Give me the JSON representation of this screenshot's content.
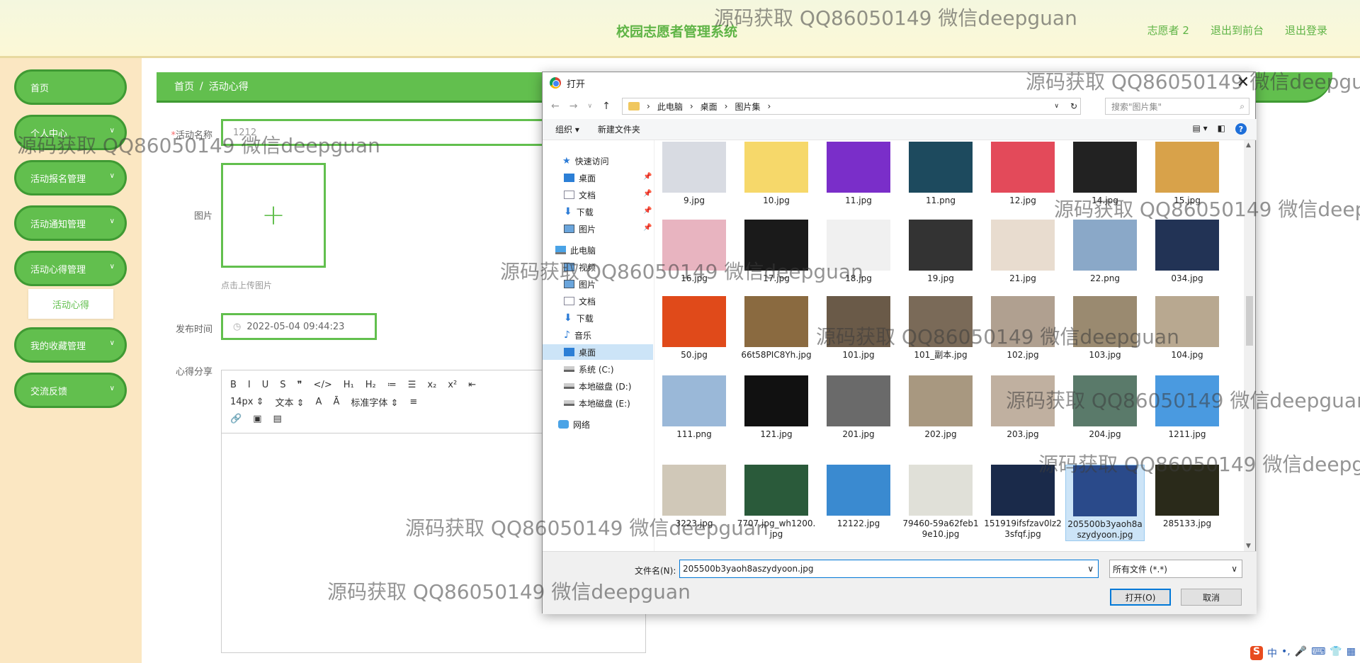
{
  "header": {
    "title": "校园志愿者管理系统",
    "links": [
      "志愿者 2",
      "退出到前台",
      "退出登录"
    ]
  },
  "sidebar": {
    "items": [
      {
        "label": "首页",
        "chevron": false
      },
      {
        "label": "个人中心",
        "chevron": true
      },
      {
        "label": "活动报名管理",
        "chevron": true
      },
      {
        "label": "活动通知管理",
        "chevron": true
      },
      {
        "label": "活动心得管理",
        "chevron": true
      },
      {
        "label": "我的收藏管理",
        "chevron": true
      },
      {
        "label": "交流反馈",
        "chevron": true
      }
    ],
    "sub_item": "活动心得"
  },
  "breadcrumb": {
    "home": "首页",
    "sep": "/",
    "current": "活动心得"
  },
  "form": {
    "name_label": "活动名称",
    "name_value": "1212",
    "image_label": "图片",
    "upload_plus": "+",
    "upload_tip": "点击上传图片",
    "time_label": "发布时间",
    "time_value": "2022-05-04 09:44:23",
    "share_label": "心得分享"
  },
  "editor": {
    "row1": [
      "B",
      "I",
      "U",
      "S",
      "❞",
      "</>",
      "H₁",
      "H₂",
      "≔",
      "☰",
      "x₂",
      "x²",
      "⇤"
    ],
    "row2": [
      "14px ⇕",
      "文本 ⇕",
      "A",
      "Ā",
      "标准字体 ⇕",
      "≡"
    ],
    "row3": [
      "🔗",
      "▣",
      "▤"
    ]
  },
  "dialog": {
    "title": "打开",
    "close": "✕",
    "path": [
      "此电脑",
      "桌面",
      "图片集"
    ],
    "search_placeholder": "搜索\"图片集\"",
    "organize": "组织 ▾",
    "new_folder": "新建文件夹",
    "help": "?",
    "tree": [
      {
        "label": "快速访问",
        "icon": "star",
        "pinned": false
      },
      {
        "label": "桌面",
        "icon": "desk",
        "pinned": true
      },
      {
        "label": "文档",
        "icon": "doc",
        "pinned": true
      },
      {
        "label": "下载",
        "icon": "dl",
        "pinned": true
      },
      {
        "label": "图片",
        "icon": "pic",
        "pinned": true
      },
      {
        "label": "此电脑",
        "icon": "pc",
        "pinned": false
      },
      {
        "label": "视频",
        "icon": "pic",
        "pinned": false
      },
      {
        "label": "图片",
        "icon": "pic",
        "pinned": false
      },
      {
        "label": "文档",
        "icon": "doc",
        "pinned": false
      },
      {
        "label": "下载",
        "icon": "dl",
        "pinned": false
      },
      {
        "label": "音乐",
        "icon": "music",
        "pinned": false
      },
      {
        "label": "桌面",
        "icon": "desk",
        "pinned": false,
        "selected": true
      },
      {
        "label": "系统 (C:)",
        "icon": "drive",
        "pinned": false
      },
      {
        "label": "本地磁盘 (D:)",
        "icon": "drive",
        "pinned": false
      },
      {
        "label": "本地磁盘 (E:)",
        "icon": "drive",
        "pinned": false
      },
      {
        "label": "网络",
        "icon": "net",
        "pinned": false
      }
    ],
    "files": [
      [
        "9.jpg",
        "#d8dbe2"
      ],
      [
        "10.jpg",
        "#f6d86a"
      ],
      [
        "11.jpg",
        "#7a2ec9"
      ],
      [
        "11.png",
        "#1d4a5e"
      ],
      [
        "12.jpg",
        "#e34a5a"
      ],
      [
        "14.jpg",
        "#222222"
      ],
      [
        "15.jpg",
        "#d8a24a"
      ],
      [
        "16.jpg",
        "#e8b4c0"
      ],
      [
        "17.jpg",
        "#1a1a1a"
      ],
      [
        "18.jpg",
        "#f0f0f0"
      ],
      [
        "19.jpg",
        "#333333"
      ],
      [
        "21.jpg",
        "#e8dccf"
      ],
      [
        "22.png",
        "#8aa8c8"
      ],
      [
        "034.jpg",
        "#223355"
      ],
      [
        "50.jpg",
        "#e04a1a"
      ],
      [
        "66t58PIC8Yh.jpg",
        "#8a6a40"
      ],
      [
        "101.jpg",
        "#6a5a48"
      ],
      [
        "101_副本.jpg",
        "#7a6a58"
      ],
      [
        "102.jpg",
        "#b0a090"
      ],
      [
        "103.jpg",
        "#9a8a70"
      ],
      [
        "104.jpg",
        "#b8a890"
      ],
      [
        "111.png",
        "#9ab8d8"
      ],
      [
        "121.jpg",
        "#111111"
      ],
      [
        "201.jpg",
        "#6a6a6a"
      ],
      [
        "202.jpg",
        "#a89880"
      ],
      [
        "203.jpg",
        "#c0b0a0"
      ],
      [
        "204.jpg",
        "#5a7a6a"
      ],
      [
        "1211.jpg",
        "#4a9ae0"
      ],
      [
        "3223.jpg",
        "#d0c8b8"
      ],
      [
        "7707.jpg_wh1200.jpg",
        "#2a5a3a"
      ],
      [
        "12122.jpg",
        "#3a8ad0"
      ],
      [
        "79460-59a62feb19e10.jpg",
        "#e0e0d8"
      ],
      [
        "151919ifsfzav0lz23sfqf.jpg",
        "#1a2a4a"
      ],
      [
        "205500b3yaoh8aszydyoon.jpg",
        "#2a4a8a"
      ],
      [
        "285133.jpg",
        "#2a2a1a"
      ]
    ],
    "selected_file": "205500b3yaoh8aszydyoon.jpg",
    "filename_label": "文件名(N):",
    "filename_value": "205500b3yaoh8aszydyoon.jpg",
    "filetype": "所有文件 (*.*)",
    "open_btn": "打开(O)",
    "cancel_btn": "取消"
  },
  "watermark": "源码获取 QQ86050149 微信deepguan",
  "ime": [
    "S",
    "中",
    "•,",
    "🎤",
    "⌨",
    "👕",
    "▦"
  ],
  "colors": {
    "accent": "#62bf4e",
    "accent_dark": "#3f9a33",
    "bg": "#fbe7c2"
  }
}
